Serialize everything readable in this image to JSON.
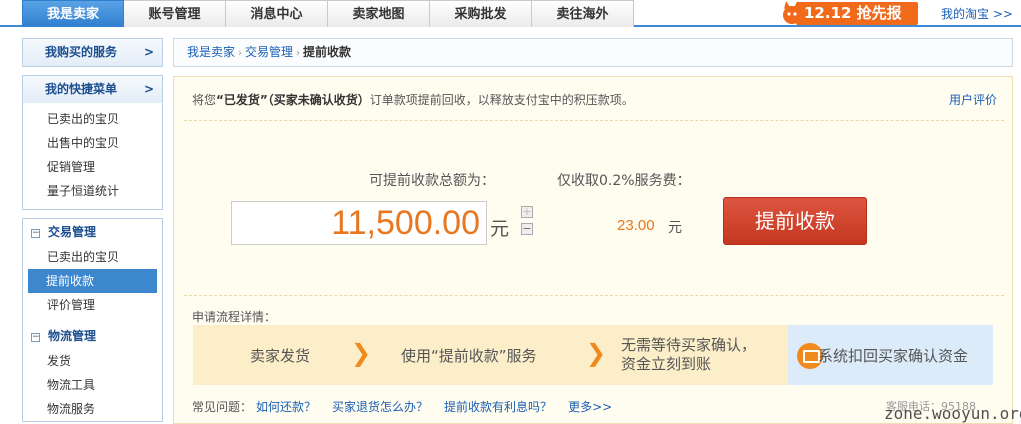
{
  "topnav": {
    "tabs": [
      {
        "label": "我是卖家",
        "active": true
      },
      {
        "label": "账号管理"
      },
      {
        "label": "消息中心"
      },
      {
        "label": "卖家地图"
      },
      {
        "label": "采购批发"
      },
      {
        "label": "卖往海外"
      }
    ],
    "promo": "12.12 抢先报",
    "my_taobao": "我的淘宝 >>"
  },
  "sidebar": {
    "bought_services": "我购买的服务",
    "shortcuts_title": "我的快捷菜单",
    "shortcuts": [
      "已卖出的宝贝",
      "出售中的宝贝",
      "促销管理",
      "量子恒道统计"
    ],
    "trade_title": "交易管理",
    "trade_items": [
      "已卖出的宝贝",
      "提前收款",
      "评价管理"
    ],
    "logistics_title": "物流管理",
    "logistics_items": [
      "发货",
      "物流工具",
      "物流服务"
    ],
    "arrow": ">",
    "collapse": "−"
  },
  "breadcrumb": {
    "items": [
      "我是卖家",
      "交易管理"
    ],
    "current": "提前收款",
    "sep": "›"
  },
  "notice": {
    "prefix": "将您",
    "highlight": "“已发货”（买家未确认收货）",
    "suffix": "订单款项提前回收，以释放支付宝中的积压款项。",
    "rating_link": "用户评价"
  },
  "form": {
    "total_label": "可提前收款总额为：",
    "amount": "11,500.00",
    "unit": "元",
    "stepper_up": "+",
    "stepper_down": "−",
    "fee_label": "仅收取0.2%服务费：",
    "fee_value": "23.00",
    "fee_unit": "元",
    "submit_label": "提前收款"
  },
  "flow": {
    "title": "申请流程详情：",
    "steps": [
      "卖家发货",
      "使用“提前收款”服务",
      "无需等待买家确认，",
      "资金立刻到账",
      "系统扣回买家确认资金"
    ],
    "chevron": "❯"
  },
  "faq": {
    "label": "常见问题：",
    "links": [
      "如何还款？",
      "买家退货怎么办？",
      "提前收款有利息吗？",
      "更多>>"
    ]
  },
  "footer": {
    "service_phone": "客服电话：95188",
    "watermark": "zone.wooyun.org"
  }
}
